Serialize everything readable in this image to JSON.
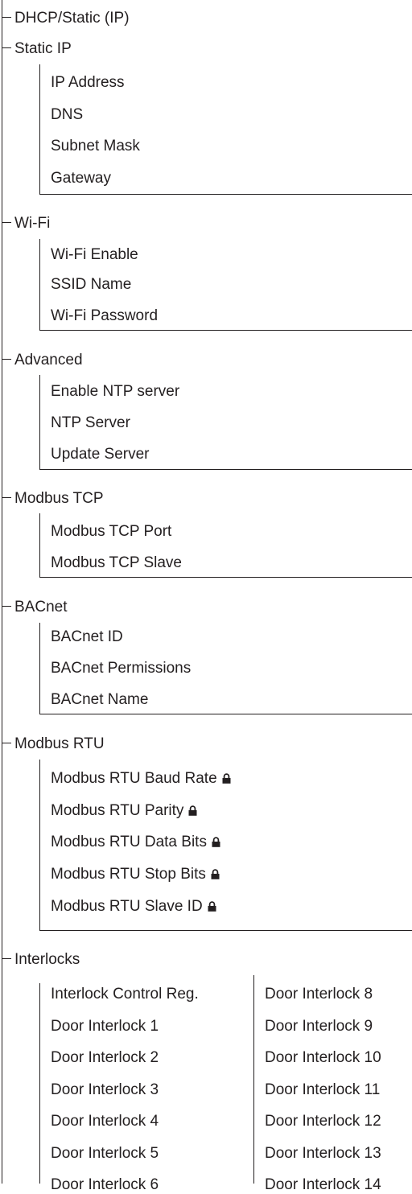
{
  "sections": {
    "dhcp": {
      "label": "DHCP/Static (IP)"
    },
    "static_ip": {
      "label": "Static IP",
      "items": [
        "IP Address",
        "DNS",
        "Subnet Mask",
        "Gateway"
      ]
    },
    "wifi": {
      "label": "Wi-Fi",
      "items": [
        "Wi-Fi Enable",
        "SSID Name",
        "Wi-Fi Password"
      ]
    },
    "advanced": {
      "label": "Advanced",
      "items": [
        "Enable NTP server",
        "NTP Server",
        "Update Server"
      ]
    },
    "modbus_tcp": {
      "label": "Modbus TCP",
      "items": [
        "Modbus TCP Port",
        "Modbus TCP Slave"
      ]
    },
    "bacnet": {
      "label": "BACnet",
      "items": [
        "BACnet ID",
        "BACnet Permissions",
        "BACnet Name"
      ]
    },
    "modbus_rtu": {
      "label": "Modbus RTU",
      "items": [
        "Modbus RTU Baud Rate",
        "Modbus RTU Parity",
        "Modbus RTU Data Bits",
        "Modbus RTU Stop Bits",
        "Modbus RTU Slave ID"
      ],
      "locked_icon": "lock-icon"
    },
    "interlocks": {
      "label": "Interlocks",
      "col1": [
        "Interlock Control Reg.",
        "Door Interlock 1",
        "Door Interlock 2",
        "Door Interlock 3",
        "Door Interlock 4",
        "Door Interlock 5",
        "Door Interlock 6"
      ],
      "col2": [
        "Door Interlock 8",
        "Door Interlock 9",
        "Door Interlock 10",
        "Door Interlock 11",
        "Door Interlock 12",
        "Door Interlock 13",
        "Door Interlock 14"
      ]
    }
  }
}
